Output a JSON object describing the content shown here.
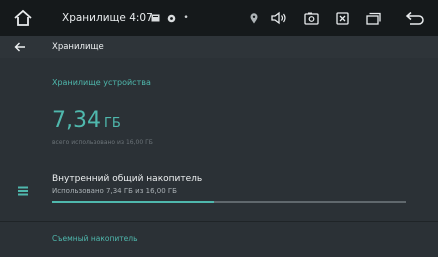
{
  "status_bar": {
    "title": "Хранилище 4:07",
    "dot": "•",
    "icons": [
      "home-icon",
      "notification-icon",
      "settings-notification-icon",
      "location-icon",
      "volume-icon",
      "screenshot-icon",
      "close-box-icon",
      "recent-apps-icon",
      "back-icon"
    ]
  },
  "toolbar": {
    "title": "Хранилище"
  },
  "device_storage": {
    "section_title": "Хранилище устройства",
    "used_value": "7,34",
    "used_unit": "ГБ",
    "used_caption": "всего использовано из 16,00 ГБ"
  },
  "internal_storage": {
    "title": "Внутренний общий накопитель",
    "subtitle": "Использовано 7,34 ГБ из 16,00 ГБ",
    "used_fraction": 0.4588
  },
  "removable_storage": {
    "section_title": "Съемный накопитель"
  },
  "colors": {
    "accent": "#4fb8ad",
    "background": "#2b3136",
    "status_bar": "#15191b"
  }
}
